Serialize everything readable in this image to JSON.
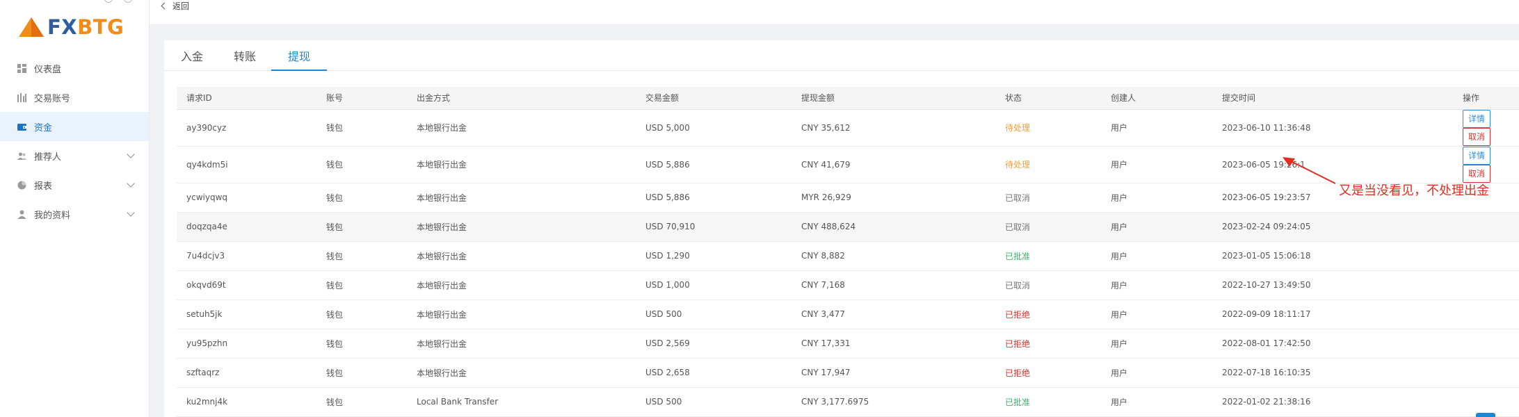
{
  "brand": {
    "fx": "FX",
    "btg": "BTG"
  },
  "topbar": {
    "back_label": "返回"
  },
  "sidebar": {
    "items": [
      {
        "label": "仪表盘",
        "icon": "dashboard-icon"
      },
      {
        "label": "交易账号",
        "icon": "chart-bars-icon"
      },
      {
        "label": "资金",
        "icon": "wallet-icon",
        "active": true
      },
      {
        "label": "推荐人",
        "icon": "users-icon"
      },
      {
        "label": "报表",
        "icon": "pie-chart-icon"
      },
      {
        "label": "我的资料",
        "icon": "user-icon"
      }
    ]
  },
  "tabs": [
    {
      "label": "入金"
    },
    {
      "label": "转账"
    },
    {
      "label": "提现",
      "active": true
    }
  ],
  "table": {
    "headers": [
      "请求ID",
      "账号",
      "出金方式",
      "交易金额",
      "提现金额",
      "状态",
      "创建人",
      "提交时间",
      "操作"
    ],
    "rows": [
      {
        "id": "ay390cyz",
        "account": "钱包",
        "method": "本地银行出金",
        "amount": "USD 5,000",
        "withdraw": "CNY 35,612",
        "status": "待处理",
        "creator": "用户",
        "time": "2023-06-10 11:36:48"
      },
      {
        "id": "qy4kdm5i",
        "account": "钱包",
        "method": "本地银行出金",
        "amount": "USD 5,886",
        "withdraw": "CNY 41,679",
        "status": "待处理",
        "creator": "用户",
        "time": "2023-06-05 19:26:1"
      },
      {
        "id": "ycwiyqwq",
        "account": "钱包",
        "method": "本地银行出金",
        "amount": "USD 5,886",
        "withdraw": "MYR 26,929",
        "status": "已取消",
        "creator": "用户",
        "time": "2023-06-05 19:23:57"
      },
      {
        "id": "doqzqa4e",
        "account": "钱包",
        "method": "本地银行出金",
        "amount": "USD 70,910",
        "withdraw": "CNY 488,624",
        "status": "已取消",
        "creator": "用户",
        "time": "2023-02-24 09:24:05"
      },
      {
        "id": "7u4dcjv3",
        "account": "钱包",
        "method": "本地银行出金",
        "amount": "USD 1,290",
        "withdraw": "CNY 8,882",
        "status": "已批准",
        "creator": "用户",
        "time": "2023-01-05 15:06:18"
      },
      {
        "id": "okqvd69t",
        "account": "钱包",
        "method": "本地银行出金",
        "amount": "USD 1,000",
        "withdraw": "CNY 7,168",
        "status": "已取消",
        "creator": "用户",
        "time": "2022-10-27 13:49:50"
      },
      {
        "id": "setuh5jk",
        "account": "钱包",
        "method": "本地银行出金",
        "amount": "USD 500",
        "withdraw": "CNY 3,477",
        "status": "已拒绝",
        "creator": "用户",
        "time": "2022-09-09 18:11:17"
      },
      {
        "id": "yu95pzhn",
        "account": "钱包",
        "method": "本地银行出金",
        "amount": "USD 2,569",
        "withdraw": "CNY 17,331",
        "status": "已拒绝",
        "creator": "用户",
        "time": "2022-08-01 17:42:50"
      },
      {
        "id": "szftaqrz",
        "account": "钱包",
        "method": "本地银行出金",
        "amount": "USD 2,658",
        "withdraw": "CNY 17,947",
        "status": "已拒绝",
        "creator": "用户",
        "time": "2022-07-18 16:10:35"
      },
      {
        "id": "ku2mnj4k",
        "account": "钱包",
        "method": "Local Bank Transfer",
        "amount": "USD 500",
        "withdraw": "CNY 3,177.6975",
        "status": "已批准",
        "creator": "用户",
        "time": "2022-01-02 21:38:16"
      }
    ],
    "actions": {
      "detail": "详情",
      "cancel": "取消"
    }
  },
  "annotation": {
    "text": "又是当没看见，不处理出金",
    "color": "#e02f1f"
  },
  "colors": {
    "accent": "#1a87d6",
    "pending": "#f0a040",
    "approved": "#3cb371",
    "rejected": "#d9322d",
    "cancelled": "#777777"
  }
}
